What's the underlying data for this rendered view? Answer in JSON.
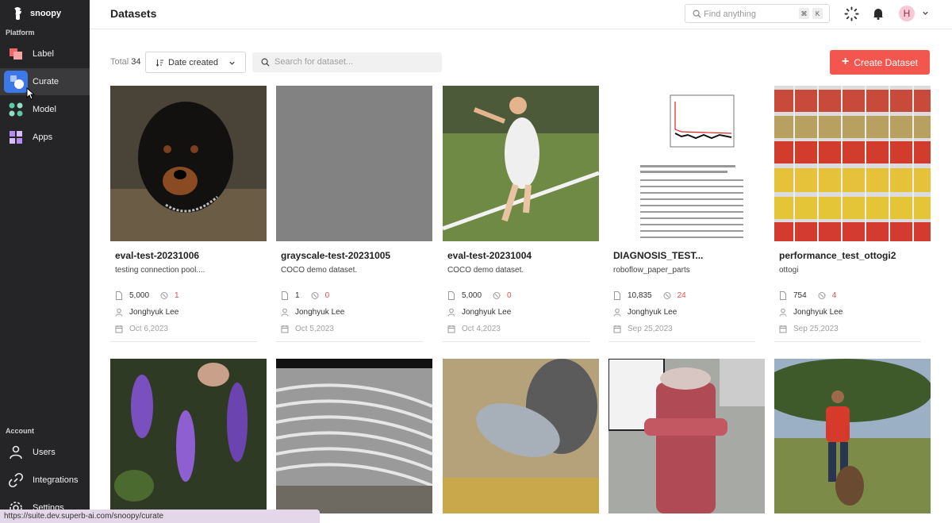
{
  "brand": {
    "name": "snoopy"
  },
  "sidebar": {
    "section_platform": "Platform",
    "section_account": "Account",
    "items": [
      {
        "label": "Label",
        "icon": "label-icon"
      },
      {
        "label": "Curate",
        "icon": "curate-icon",
        "active": true
      },
      {
        "label": "Model",
        "icon": "model-icon"
      },
      {
        "label": "Apps",
        "icon": "apps-icon"
      }
    ],
    "account_items": [
      {
        "label": "Users",
        "icon": "user-icon"
      },
      {
        "label": "Integrations",
        "icon": "link-icon"
      },
      {
        "label": "Settings",
        "icon": "gear-icon"
      }
    ]
  },
  "header": {
    "title": "Datasets",
    "search_placeholder": "Find anything",
    "shortcut_keys": [
      "⌘",
      "K"
    ],
    "avatar_initial": "H"
  },
  "toolbar": {
    "total_label": "Total",
    "total_count": "34",
    "sort_value": "Date created",
    "search_placeholder": "Search for dataset...",
    "create_label": "Create Dataset"
  },
  "colors": {
    "accent": "#f2564f",
    "active_nav": "#3c78e8",
    "sidebar_bg": "#252527"
  },
  "datasets": [
    {
      "name": "eval-test-20231006",
      "desc": "testing connection pool....",
      "count": "5,000",
      "issues": "1",
      "owner": "Jonghyuk Lee",
      "date": "Oct 6,2023"
    },
    {
      "name": "grayscale-test-20231005",
      "desc": "COCO demo dataset.",
      "count": "1",
      "issues": "0",
      "owner": "Jonghyuk Lee",
      "date": "Oct 5,2023"
    },
    {
      "name": "eval-test-20231004",
      "desc": "COCO demo dataset.",
      "count": "5,000",
      "issues": "0",
      "owner": "Jonghyuk Lee",
      "date": "Oct 4,2023"
    },
    {
      "name": "DIAGNOSIS_TEST...",
      "desc": "roboflow_paper_parts",
      "count": "10,835",
      "issues": "24",
      "owner": "Jonghyuk Lee",
      "date": "Sep 25,2023"
    },
    {
      "name": "performance_test_ottogi2",
      "desc": "ottogi",
      "count": "754",
      "issues": "4",
      "owner": "Jonghyuk Lee",
      "date": "Sep 25,2023"
    }
  ],
  "status_url": "https://suite.dev.superb-ai.com/snoopy/curate"
}
